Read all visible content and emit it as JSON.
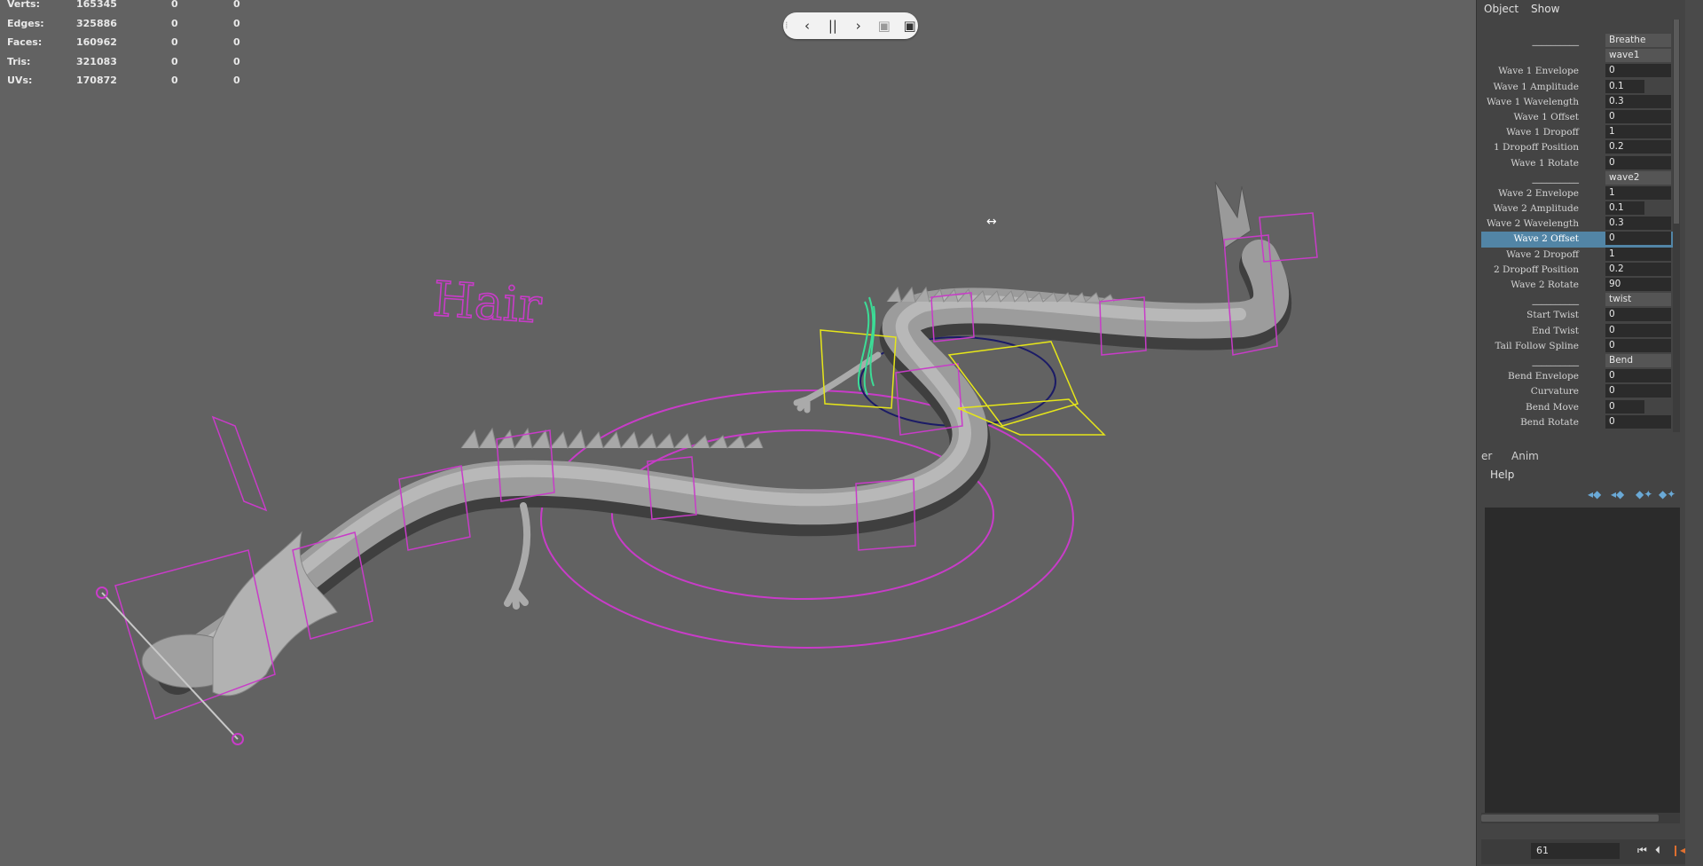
{
  "stats": {
    "rows": [
      {
        "label": "Verts:",
        "v1": "165345",
        "v2": "0",
        "v3": "0"
      },
      {
        "label": "Edges:",
        "v1": "325886",
        "v2": "0",
        "v3": "0"
      },
      {
        "label": "Faces:",
        "v1": "160962",
        "v2": "0",
        "v3": "0"
      },
      {
        "label": "Tris:",
        "v1": "321083",
        "v2": "0",
        "v3": "0"
      },
      {
        "label": "UVs:",
        "v1": "170872",
        "v2": "0",
        "v3": "0"
      }
    ]
  },
  "viewport": {
    "hair_label": "Hair",
    "playback_pill": {
      "prev": "‹",
      "pause": "||",
      "next": "›"
    }
  },
  "panel": {
    "menu": {
      "object": "Object",
      "show": "Show"
    },
    "attributes": [
      {
        "label": "__________",
        "value": "Breathe",
        "header": true
      },
      {
        "label": "",
        "value": "wave1",
        "header": true
      },
      {
        "label": "Wave 1 Envelope",
        "value": "0"
      },
      {
        "label": "Wave 1 Amplitude",
        "value": "0.1"
      },
      {
        "label": "Wave 1 Wavelength",
        "value": "0.3"
      },
      {
        "label": "Wave 1 Offset",
        "value": "0"
      },
      {
        "label": "Wave 1 Dropoff",
        "value": "1"
      },
      {
        "label": "1 Dropoff Position",
        "value": "0.2"
      },
      {
        "label": "Wave 1 Rotate",
        "value": "0"
      },
      {
        "label": "__________",
        "value": "wave2",
        "header": true
      },
      {
        "label": "Wave 2 Envelope",
        "value": "1"
      },
      {
        "label": "Wave 2 Amplitude",
        "value": "0.1"
      },
      {
        "label": "Wave 2 Wavelength",
        "value": "0.3"
      },
      {
        "label": "Wave 2 Offset",
        "value": "0",
        "selected": true
      },
      {
        "label": "Wave 2 Dropoff",
        "value": "1"
      },
      {
        "label": "2 Dropoff Position",
        "value": "0.2"
      },
      {
        "label": "Wave 2 Rotate",
        "value": "90"
      },
      {
        "label": "__________",
        "value": "twist",
        "header": true
      },
      {
        "label": "Start Twist",
        "value": "0"
      },
      {
        "label": "End Twist",
        "value": "0"
      },
      {
        "label": "Tail Follow Spline",
        "value": "0"
      },
      {
        "label": "__________",
        "value": "Bend",
        "header": true
      },
      {
        "label": "Bend Envelope",
        "value": "0"
      },
      {
        "label": "Curvature",
        "value": "0"
      },
      {
        "label": "Bend Move",
        "value": "0"
      },
      {
        "label": "Bend Rotate",
        "value": "0"
      }
    ],
    "tabs": {
      "left": "er",
      "anim": "Anim"
    },
    "help": "Help",
    "timeline": {
      "current_frame": "61"
    }
  },
  "colors": {
    "accent_selection": "#5285a6",
    "rig_magenta": "#c83cc8",
    "rig_yellow": "#e6e619",
    "rig_green": "#3cdc96"
  }
}
